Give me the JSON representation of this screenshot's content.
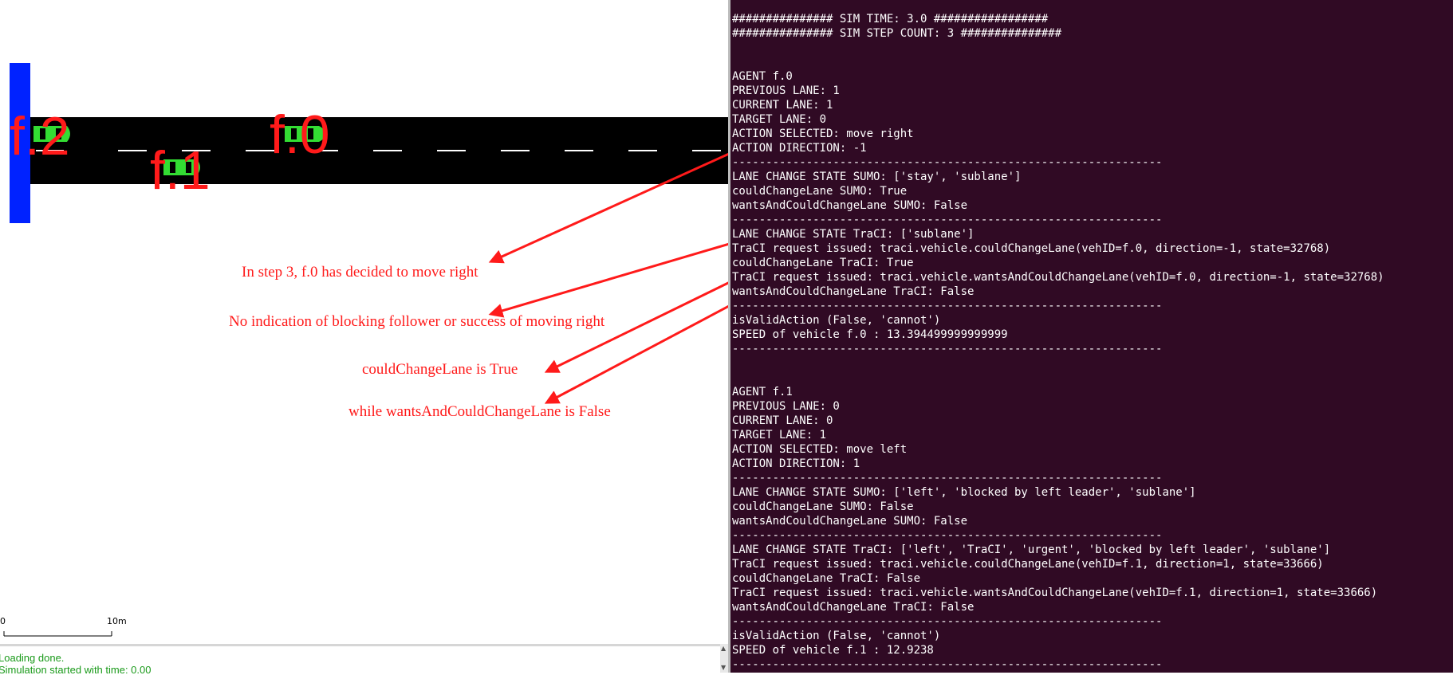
{
  "simulation": {
    "vehicles": [
      {
        "id": "f.2",
        "color": "#33dd33"
      },
      {
        "id": "f.1",
        "color": "#33dd33"
      },
      {
        "id": "f.0",
        "color": "#33dd33"
      }
    ],
    "road_color": "#000000",
    "marker_color": "#0022ff",
    "label_color": "#ff1a1a",
    "scale_bar": {
      "start_label": "0",
      "end_label": "10m"
    }
  },
  "annotations": [
    "In step 3, f.0 has decided to move right",
    "No indication of blocking follower or success of moving right",
    "couldChangeLane is True",
    "while wantsAndCouldChangeLane is False"
  ],
  "messages": [
    "Loading done.",
    "Simulation started with time: 0.00"
  ],
  "terminal": {
    "background": "#300a24",
    "lines": [
      "############### SIM TIME: 3.0 #################",
      "############### SIM STEP COUNT: 3 ###############",
      "",
      "",
      "AGENT f.0",
      "PREVIOUS LANE: 1",
      "CURRENT LANE: 1",
      "TARGET LANE: 0",
      "ACTION SELECTED: move right",
      "ACTION DIRECTION: -1",
      "----------------------------------------------------------------",
      "LANE CHANGE STATE SUMO: ['stay', 'sublane']",
      "couldChangeLane SUMO: True",
      "wantsAndCouldChangeLane SUMO: False",
      "----------------------------------------------------------------",
      "LANE CHANGE STATE TraCI: ['sublane']",
      "TraCI request issued: traci.vehicle.couldChangeLane(vehID=f.0, direction=-1, state=32768)",
      "couldChangeLane TraCI: True",
      "TraCI request issued: traci.vehicle.wantsAndCouldChangeLane(vehID=f.0, direction=-1, state=32768)",
      "wantsAndCouldChangeLane TraCI: False",
      "----------------------------------------------------------------",
      "isValidAction (False, 'cannot')",
      "SPEED of vehicle f.0 : 13.394499999999999",
      "----------------------------------------------------------------",
      "",
      "",
      "AGENT f.1",
      "PREVIOUS LANE: 0",
      "CURRENT LANE: 0",
      "TARGET LANE: 1",
      "ACTION SELECTED: move left",
      "ACTION DIRECTION: 1",
      "----------------------------------------------------------------",
      "LANE CHANGE STATE SUMO: ['left', 'blocked by left leader', 'sublane']",
      "couldChangeLane SUMO: False",
      "wantsAndCouldChangeLane SUMO: False",
      "----------------------------------------------------------------",
      "LANE CHANGE STATE TraCI: ['left', 'TraCI', 'urgent', 'blocked by left leader', 'sublane']",
      "TraCI request issued: traci.vehicle.couldChangeLane(vehID=f.1, direction=1, state=33666)",
      "couldChangeLane TraCI: False",
      "TraCI request issued: traci.vehicle.wantsAndCouldChangeLane(vehID=f.1, direction=1, state=33666)",
      "wantsAndCouldChangeLane TraCI: False",
      "----------------------------------------------------------------",
      "isValidAction (False, 'cannot')",
      "SPEED of vehicle f.1 : 12.9238",
      "----------------------------------------------------------------"
    ]
  }
}
